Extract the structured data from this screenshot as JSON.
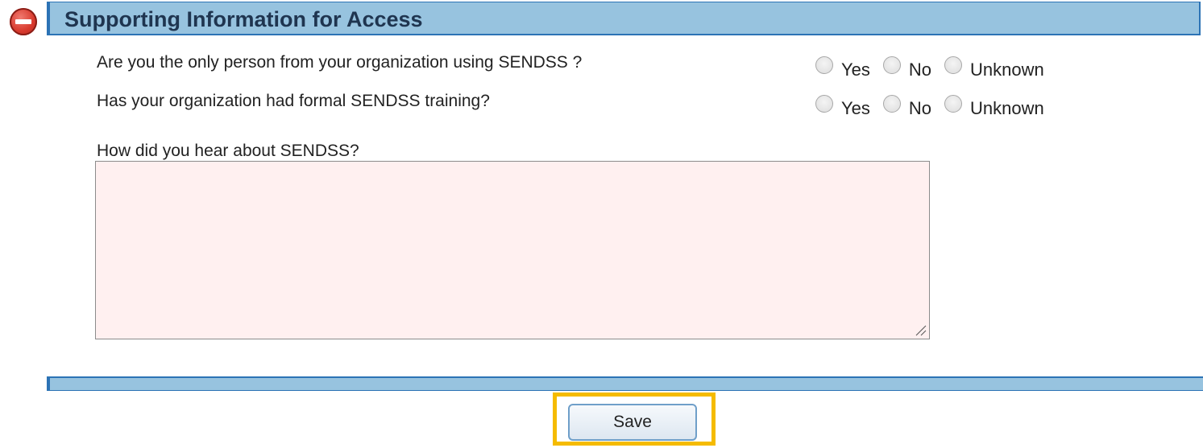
{
  "section": {
    "title": "Supporting Information for Access",
    "collapse_icon": "minus-circle-icon",
    "accent_color": "#2c73b5",
    "header_bg": "#97c3df"
  },
  "questions": [
    {
      "text": "Are you the only person from your organization using SENDSS ?",
      "options": [
        "Yes",
        "No",
        "Unknown"
      ],
      "selected": null
    },
    {
      "text": "Has your organization had formal SENDSS training?",
      "options": [
        "Yes",
        "No",
        "Unknown"
      ],
      "selected": null
    }
  ],
  "hear_about": {
    "label": "How did you hear about SENDSS?",
    "value": "",
    "background": "#fff0f0"
  },
  "actions": {
    "save_label": "Save",
    "highlight_color": "#f5bb00"
  }
}
